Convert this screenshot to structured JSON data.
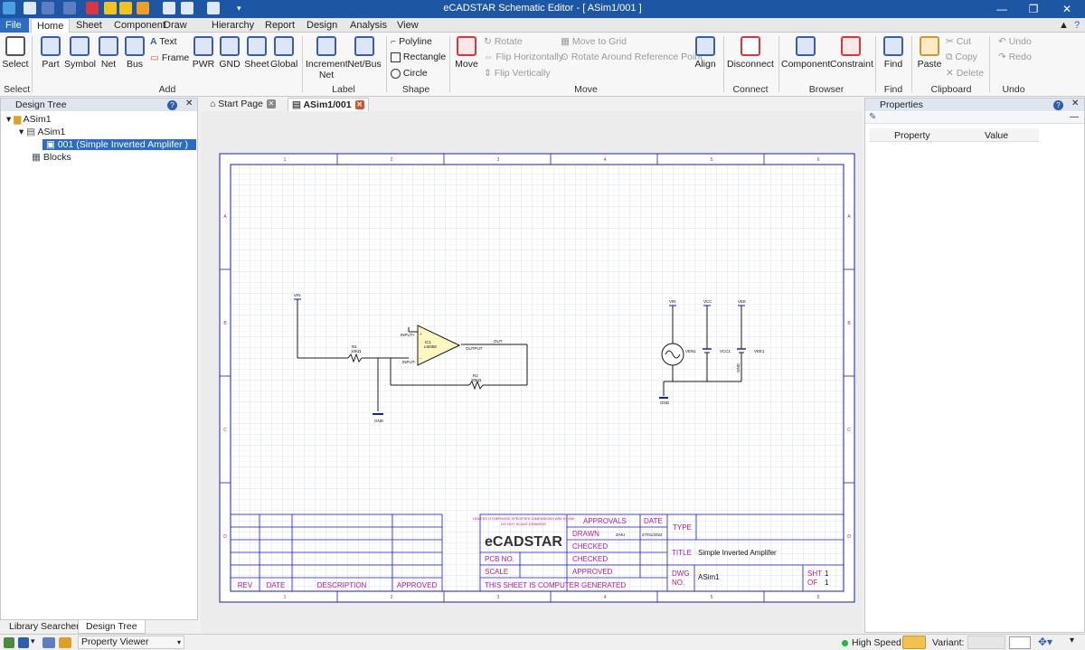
{
  "app": {
    "title": "eCADSTAR Schematic Editor - [ ASim1/001 ]"
  },
  "menu": {
    "file": "File",
    "tabs": [
      "Home",
      "Sheet",
      "Component",
      "Draw",
      "Hierarchy",
      "Report",
      "Design",
      "Analysis",
      "View"
    ]
  },
  "ribbon": {
    "select": {
      "label": "Select",
      "group": "Select"
    },
    "add": {
      "part": "Part",
      "symbol": "Symbol",
      "net": "Net",
      "bus": "Bus",
      "text": "Text",
      "frame": "Frame",
      "pwr": "PWR",
      "gnd": "GND",
      "sheet": "Sheet",
      "global": "Global",
      "group": "Add"
    },
    "label": {
      "increment": "Increment Net",
      "netbus": "Net/Bus",
      "group": "Label"
    },
    "shape": {
      "polyline": "Polyline",
      "rectangle": "Rectangle",
      "circle": "Circle",
      "group": "Shape"
    },
    "move": {
      "move": "Move",
      "rotate": "Rotate",
      "flip_h": "Flip Horizontally",
      "flip_v": "Flip Vertically",
      "move_grid": "Move to Grid",
      "rotate_ref": "Rotate Around Reference Point",
      "align": "Align",
      "group": "Move"
    },
    "connect": {
      "disconnect": "Disconnect",
      "group": "Connect"
    },
    "browser": {
      "component": "Component",
      "constraint": "Constraint",
      "group": "Browser"
    },
    "find": {
      "find": "Find",
      "group": "Find"
    },
    "clipboard": {
      "paste": "Paste",
      "cut": "Cut",
      "copy": "Copy",
      "delete": "Delete",
      "group": "Clipboard"
    },
    "undo": {
      "undo": "Undo",
      "redo": "Redo",
      "group": "Undo"
    }
  },
  "design_tree": {
    "title": "Design Tree",
    "items": [
      "ASim1",
      "ASim1",
      "001 (Simple Inverted Amplifer )",
      "Blocks"
    ]
  },
  "doc_tabs": {
    "start": "Start Page",
    "sheet": "ASim1/001"
  },
  "properties": {
    "title": "Properties",
    "col_property": "Property",
    "col_value": "Value"
  },
  "bottom_tabs": {
    "library": "Library Searcher",
    "tree": "Design Tree"
  },
  "status": {
    "property_viewer": "Property Viewer",
    "high_speed": "High Speed",
    "variant": "Variant:"
  },
  "colors": {
    "accent": "#2b6cc4",
    "sheet_border": "#1a1acd",
    "title_text": "#b5179e",
    "titlebar": "#1e56a6"
  },
  "schematic": {
    "zones_cols": [
      "1",
      "2",
      "3",
      "4",
      "5",
      "6"
    ],
    "zones_rows": [
      "A",
      "B",
      "C",
      "D"
    ],
    "components": {
      "vin_port": "VIN",
      "r1_ref": "R1",
      "r1_val": "10KΩ",
      "ic_ref": "IC1",
      "ic_val": "LM358",
      "ic_pin_plus": "INPUT+",
      "ic_pin_minus": "INPUT-",
      "ic_pin_out": "OUTPUT",
      "out_label": "OUT",
      "r2_ref": "R2",
      "r2_val": "20KΩ",
      "gnd1": "GND",
      "vin2": "VIN",
      "vcc": "VCC",
      "vee": "VEE",
      "ven1": "VEN1",
      "vcc1": "VCC1",
      "vee1": "VEE1",
      "gnd2": "GND",
      "gnd_net": "GND"
    },
    "title_block": {
      "rev": "REV",
      "date": "DATE",
      "description": "DESCRIPTION",
      "approved": "APPROVED",
      "approvals": "APPROVALS",
      "date2": "DATE",
      "drawn": "DRAWN",
      "drawn_by": "ZAKI",
      "drawn_date": "27/01/2022",
      "checked": "CHECKED",
      "checked2": "CHECKED",
      "pcb_no": "PCB NO.",
      "scale": "SCALE",
      "approved2": "APPROVED",
      "computer_generated": "THIS SHEET IS COMPUTER GENERATED",
      "type": "TYPE",
      "title_label": "TITLE",
      "title_value": "Simple Inverted Amplifer",
      "dwg": "DWG",
      "no": "NO.",
      "dwg_value": "ASim1",
      "sht": "SHT",
      "sht_val": "1",
      "of": "OF",
      "of_val": "1",
      "logo": "eCADSTAR",
      "note1": "UNLESS OTHERWISE SPECIFIED DIMENSIONS ARE IN MM",
      "note2": "DO NOT SCALE DRAWING"
    }
  }
}
